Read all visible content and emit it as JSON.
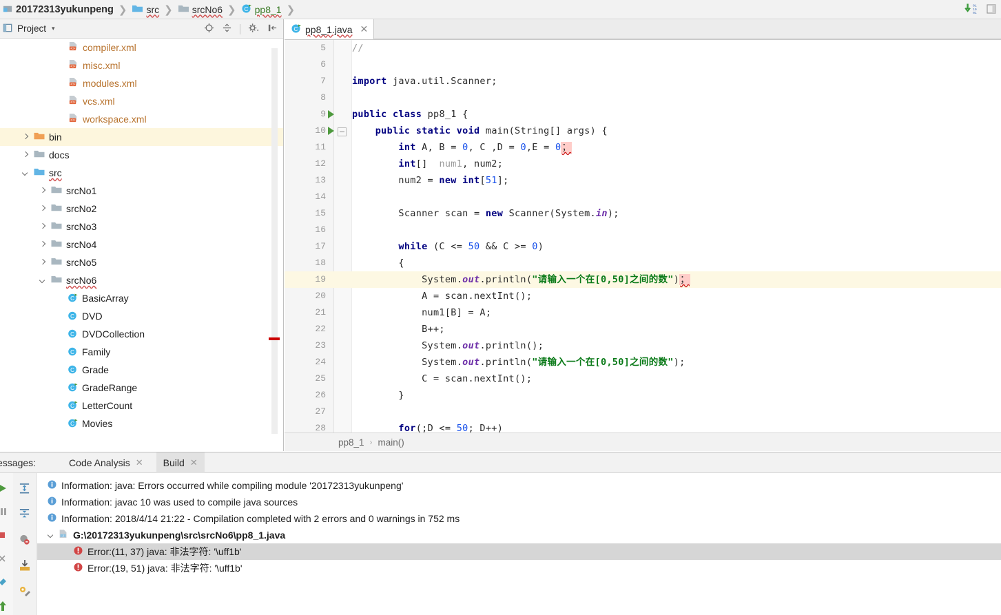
{
  "navbar": {
    "crumbs": [
      {
        "label": "20172313yukunpeng",
        "icon": "module-icon",
        "style": "bold"
      },
      {
        "label": "src",
        "icon": "source-folder-icon",
        "style": "spell"
      },
      {
        "label": "srcNo6",
        "icon": "folder-icon",
        "style": "spell"
      },
      {
        "label": "pp8_1",
        "icon": "java-class-icon",
        "style": "green-spell"
      }
    ],
    "separator": "❯",
    "right_icons": [
      "download-update-icon",
      "sidebar-toggle-icon"
    ]
  },
  "project_panel": {
    "title": "Project",
    "caret": "▾",
    "header_icons": [
      "locate-icon",
      "collapse-all-icon",
      "settings-gear-icon",
      "hide-panel-icon"
    ],
    "tree": [
      {
        "label": "compiler.xml",
        "indent": 3,
        "arrow": "none",
        "icon": "xml-file-icon",
        "kind": "xml"
      },
      {
        "label": "misc.xml",
        "indent": 3,
        "arrow": "none",
        "icon": "xml-file-icon",
        "kind": "xml"
      },
      {
        "label": "modules.xml",
        "indent": 3,
        "arrow": "none",
        "icon": "xml-file-icon",
        "kind": "xml"
      },
      {
        "label": "vcs.xml",
        "indent": 3,
        "arrow": "none",
        "icon": "xml-file-icon",
        "kind": "xml"
      },
      {
        "label": "workspace.xml",
        "indent": 3,
        "arrow": "none",
        "icon": "xml-file-icon",
        "kind": "xml"
      },
      {
        "label": "bin",
        "indent": 1,
        "arrow": "right",
        "icon": "folder-orange-icon",
        "kind": "folder",
        "highlighted": true
      },
      {
        "label": "docs",
        "indent": 1,
        "arrow": "right",
        "icon": "folder-gray-icon",
        "kind": "folder"
      },
      {
        "label": "src",
        "indent": 1,
        "arrow": "down",
        "icon": "source-folder-icon",
        "kind": "folder",
        "spell": true
      },
      {
        "label": "srcNo1",
        "indent": 2,
        "arrow": "right",
        "icon": "folder-gray-icon",
        "kind": "folder"
      },
      {
        "label": "srcNo2",
        "indent": 2,
        "arrow": "right",
        "icon": "folder-gray-icon",
        "kind": "folder"
      },
      {
        "label": "srcNo3",
        "indent": 2,
        "arrow": "right",
        "icon": "folder-gray-icon",
        "kind": "folder"
      },
      {
        "label": "srcNo4",
        "indent": 2,
        "arrow": "right",
        "icon": "folder-gray-icon",
        "kind": "folder"
      },
      {
        "label": "srcNo5",
        "indent": 2,
        "arrow": "right",
        "icon": "folder-gray-icon",
        "kind": "folder"
      },
      {
        "label": "srcNo6",
        "indent": 2,
        "arrow": "down",
        "icon": "folder-gray-icon",
        "kind": "folder",
        "spell": true
      },
      {
        "label": "BasicArray",
        "indent": 3,
        "arrow": "none",
        "icon": "java-class-run-icon",
        "kind": "class"
      },
      {
        "label": "DVD",
        "indent": 3,
        "arrow": "none",
        "icon": "java-class-icon",
        "kind": "class"
      },
      {
        "label": "DVDCollection",
        "indent": 3,
        "arrow": "none",
        "icon": "java-class-icon",
        "kind": "class"
      },
      {
        "label": "Family",
        "indent": 3,
        "arrow": "none",
        "icon": "java-class-icon",
        "kind": "class"
      },
      {
        "label": "Grade",
        "indent": 3,
        "arrow": "none",
        "icon": "java-class-icon",
        "kind": "class"
      },
      {
        "label": "GradeRange",
        "indent": 3,
        "arrow": "none",
        "icon": "java-class-run-icon",
        "kind": "class"
      },
      {
        "label": "LetterCount",
        "indent": 3,
        "arrow": "none",
        "icon": "java-class-run-icon",
        "kind": "class"
      },
      {
        "label": "Movies",
        "indent": 3,
        "arrow": "none",
        "icon": "java-class-run-icon",
        "kind": "class"
      }
    ]
  },
  "editor": {
    "tab": {
      "label": "pp8_1.java",
      "icon": "java-class-run-icon",
      "close": "✕"
    },
    "first_line_number": 5,
    "highlighted_line": 19,
    "run_marker_lines": [
      9,
      10
    ],
    "fold_marker_line": 10,
    "lines": [
      {
        "n": 5,
        "text": "//"
      },
      {
        "n": 6,
        "text": ""
      },
      {
        "n": 7,
        "text": "import java.util.Scanner;"
      },
      {
        "n": 8,
        "text": ""
      },
      {
        "n": 9,
        "text": "public class pp8_1 {"
      },
      {
        "n": 10,
        "text": "    public static void main(String[] args) {"
      },
      {
        "n": 11,
        "text": "        int A, B = 0, C ,D = 0,E = 0；"
      },
      {
        "n": 12,
        "text": "        int[]  num1, num2;"
      },
      {
        "n": 13,
        "text": "        num2 = new int[51];"
      },
      {
        "n": 14,
        "text": ""
      },
      {
        "n": 15,
        "text": "        Scanner scan = new Scanner(System.in);"
      },
      {
        "n": 16,
        "text": ""
      },
      {
        "n": 17,
        "text": "        while (C <= 50 && C >= 0)"
      },
      {
        "n": 18,
        "text": "        {"
      },
      {
        "n": 19,
        "text": "            System.out.println(\"请输入一个在[0,50]之间的数\")；"
      },
      {
        "n": 20,
        "text": "            A = scan.nextInt();"
      },
      {
        "n": 21,
        "text": "            num1[B] = A;"
      },
      {
        "n": 22,
        "text": "            B++;"
      },
      {
        "n": 23,
        "text": "            System.out.println();"
      },
      {
        "n": 24,
        "text": "            System.out.println(\"请输入一个在[0,50]之间的数\");"
      },
      {
        "n": 25,
        "text": "            C = scan.nextInt();"
      },
      {
        "n": 26,
        "text": "        }"
      },
      {
        "n": 27,
        "text": ""
      },
      {
        "n": 28,
        "text": "        for(;D <= 50; D++)"
      }
    ],
    "breadcrumb": {
      "items": [
        "pp8_1",
        "main()"
      ],
      "separator": "›"
    }
  },
  "messages_panel": {
    "title": "essages:",
    "tabs": [
      {
        "label": "Code Analysis",
        "active": false,
        "close": "✕"
      },
      {
        "label": "Build",
        "active": true,
        "close": "✕"
      }
    ],
    "toolbar_icons": [
      "expand-all-icon",
      "collapse-all-icon",
      "hide-warnings-icon",
      "export-icon",
      "settings-wrench-icon"
    ],
    "side_icons": [
      "run-icon",
      "pause-icon",
      "stop-icon",
      "close-icon",
      "pin-icon",
      "scroll-up-icon"
    ],
    "rows": [
      {
        "icon": "info-icon",
        "text": "Information: java: Errors occurred while compiling module '20172313yukunpeng'",
        "indent": 1,
        "selected": false,
        "bold": false
      },
      {
        "icon": "info-icon",
        "text": "Information: javac 10 was used to compile java sources",
        "indent": 1,
        "selected": false,
        "bold": false
      },
      {
        "icon": "info-icon",
        "text": "Information: 2018/4/14 21:22 - Compilation completed with 2 errors and 0 warnings in 752 ms",
        "indent": 1,
        "selected": false,
        "bold": false
      },
      {
        "icon": "java-file-icon",
        "arrow": "down",
        "text": "G:\\20172313yukunpeng\\src\\srcNo6\\pp8_1.java",
        "indent": 1,
        "selected": false,
        "bold": true
      },
      {
        "icon": "error-icon",
        "text": "Error:(11, 37)  java: 非法字符: '\\uff1b'",
        "indent": 2,
        "selected": true,
        "bold": false
      },
      {
        "icon": "error-icon",
        "text": "Error:(19, 51)  java: 非法字符: '\\uff1b'",
        "indent": 2,
        "selected": false,
        "bold": false
      }
    ]
  },
  "colors": {
    "accent_blue": "#1750eb",
    "keyword": "#000080",
    "string_green": "#0a7a18",
    "error_red": "#cc0000",
    "highlight_yellow": "#fdf8e3",
    "panel_gray": "#f2f2f2"
  }
}
